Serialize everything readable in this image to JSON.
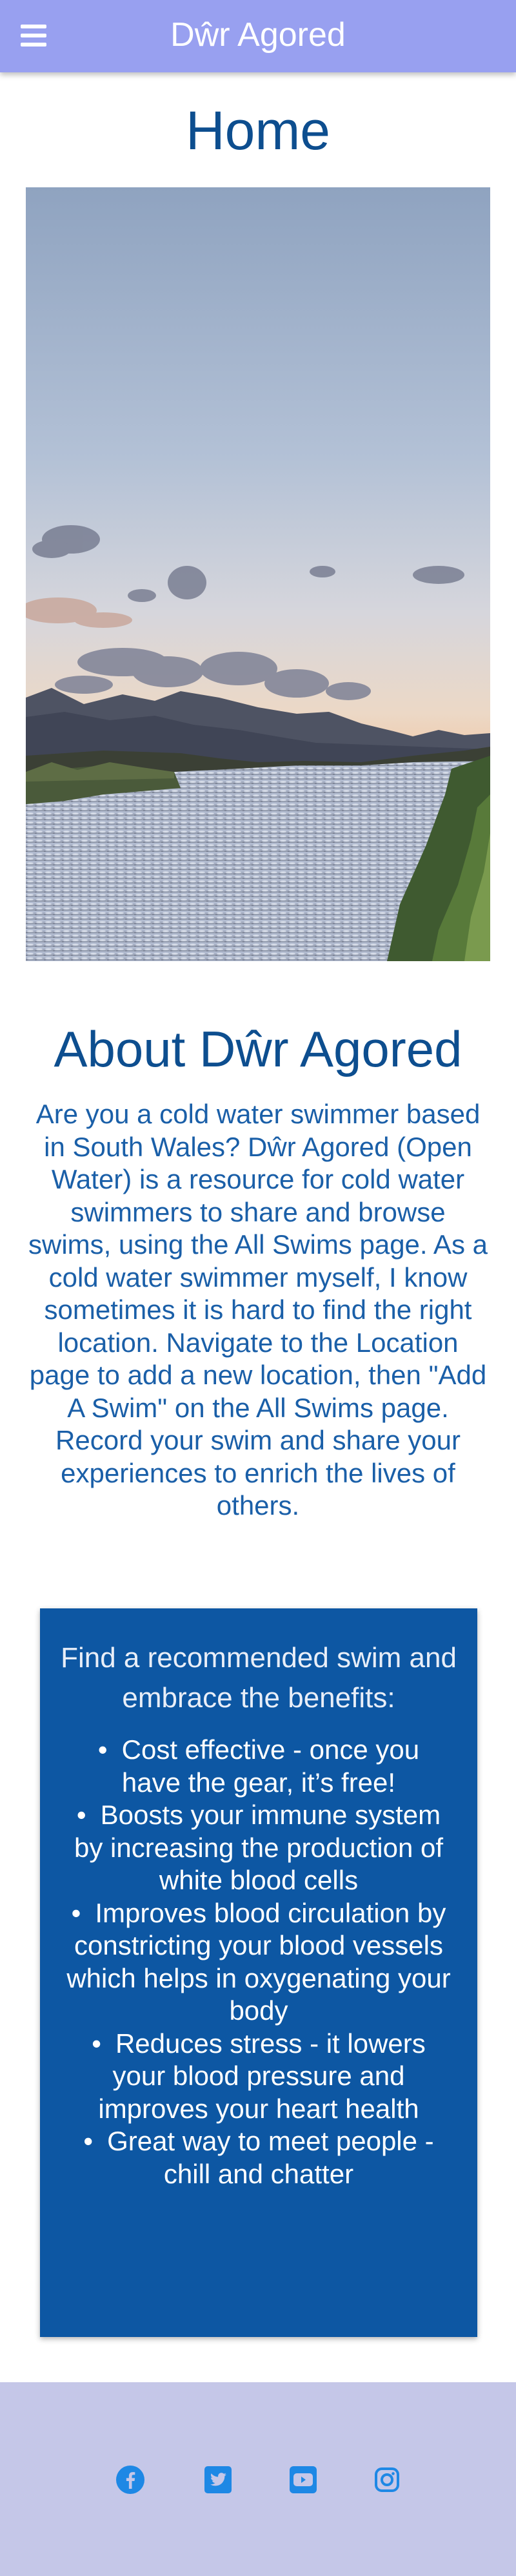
{
  "header": {
    "menu_icon": "hamburger-menu-icon",
    "brand": "Dŵr Agored",
    "colors": {
      "background": "#98a0f0",
      "text": "#ffffff"
    }
  },
  "main": {
    "title": "Home",
    "hero_image": "lake-landscape-at-dusk"
  },
  "about": {
    "title": "About Dŵr Agored",
    "text": "Are you a cold water swimmer based in South Wales? Dŵr Agored (Open Water) is a resource for cold water swimmers to share and browse swims, using the All Swims page. As a cold water swimmer myself, I know sometimes it is hard to find the right location. Navigate to the Location page to add a new location, then \"Add A Swim\" on the All Swims page. Record your swim and share your experiences to enrich the lives of others."
  },
  "benefits": {
    "intro": "Find a recommended swim and embrace the benefits:",
    "items": [
      "Cost effective - once you have the gear, it’s free!",
      "Boosts your immune system by increasing the production of white blood cells",
      "Improves blood circulation by constricting your blood vessels which helps in oxygenating your body",
      "Reduces stress - it lowers your blood pressure and improves your heart health",
      "Great way to meet people - chill and chatter"
    ],
    "colors": {
      "background": "#0d57a3",
      "text": "#ffffff"
    }
  },
  "footer": {
    "social_icons": [
      "facebook-icon",
      "twitter-icon",
      "youtube-icon",
      "instagram-icon"
    ],
    "colors": {
      "background": "#c5c7e8",
      "icon": "#1e88e5"
    }
  },
  "colors": {
    "heading": "#0d4e8f",
    "body_text": "#1a5fa8"
  }
}
